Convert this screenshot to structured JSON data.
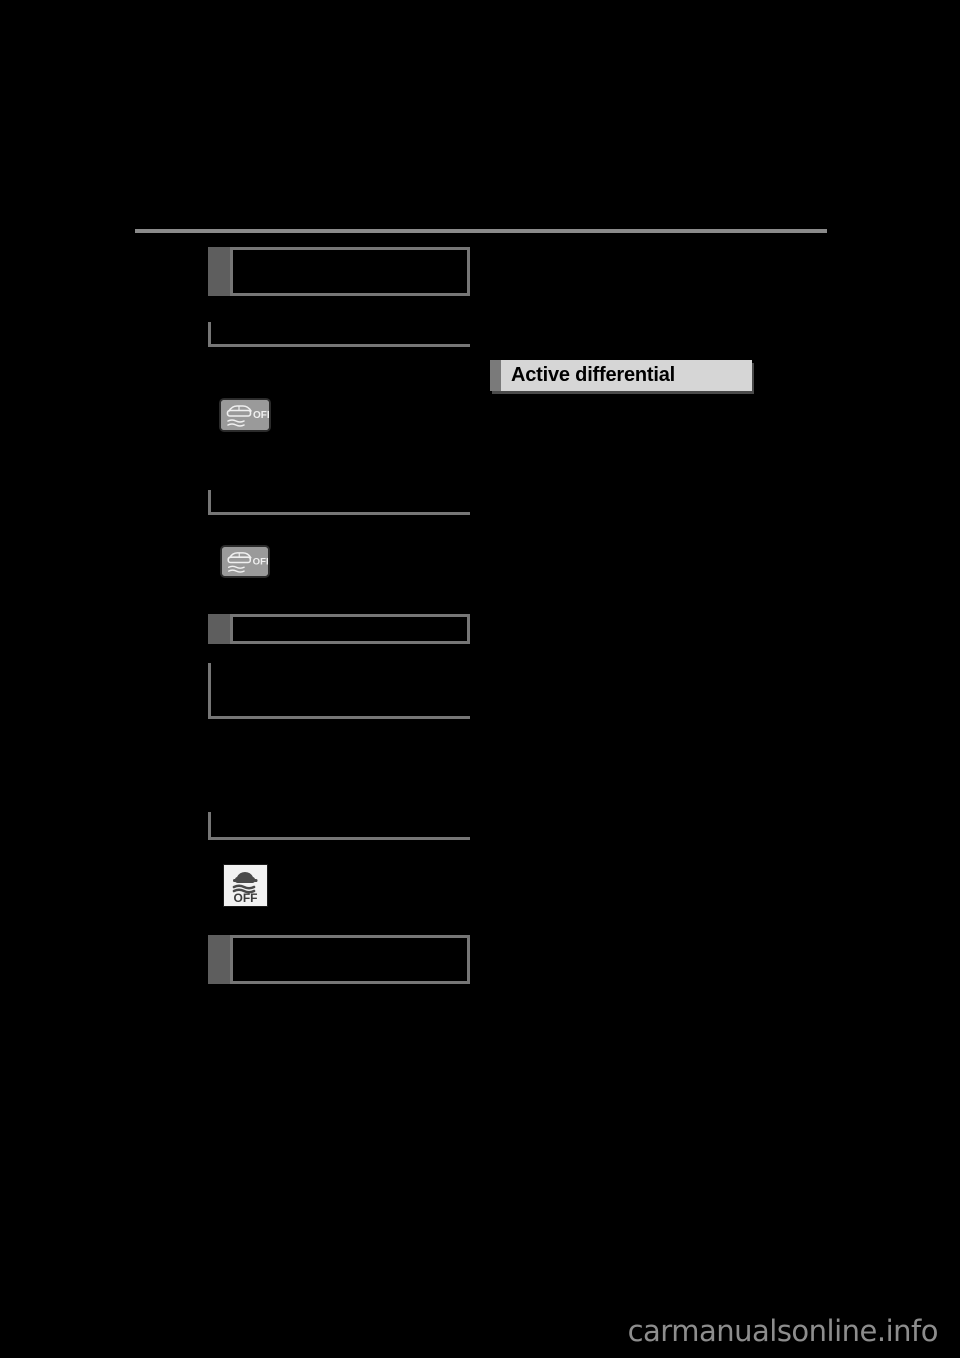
{
  "page": {
    "background_color": "#000000",
    "rule_color": "#8a8a8a",
    "box_border_color": "#767676",
    "tab_color": "#5e5e5e",
    "heading_bg_color": "#d6d6d6",
    "heading_tab_color": "#7a7a7a"
  },
  "header": {
    "rule_label": "header-rule"
  },
  "left_column": {
    "notice_boxes": [
      {
        "id": "notice-top",
        "text": ""
      },
      {
        "id": "notice-middle",
        "text": ""
      },
      {
        "id": "notice-bottom",
        "text": ""
      }
    ],
    "rule_blocks": [
      {
        "id": "rule-block-1",
        "text": ""
      },
      {
        "id": "rule-block-2",
        "text": ""
      },
      {
        "id": "rule-block-3",
        "text": ""
      },
      {
        "id": "rule-block-4",
        "text": ""
      }
    ],
    "indicators": [
      {
        "id": "vsc-off-indicator-1",
        "name": "vsc-off-icon",
        "label": "OFF",
        "style": "gray-panel"
      },
      {
        "id": "vsc-off-indicator-2",
        "name": "vsc-off-icon",
        "label": "OFF",
        "style": "gray-panel"
      },
      {
        "id": "vsc-off-indicator-3",
        "name": "vsc-off-white-icon",
        "label": "OFF",
        "style": "white-panel"
      }
    ]
  },
  "right_column": {
    "section_heading": {
      "title": "Active differential"
    }
  },
  "footer": {
    "watermark": "carmanualsonline.info"
  }
}
